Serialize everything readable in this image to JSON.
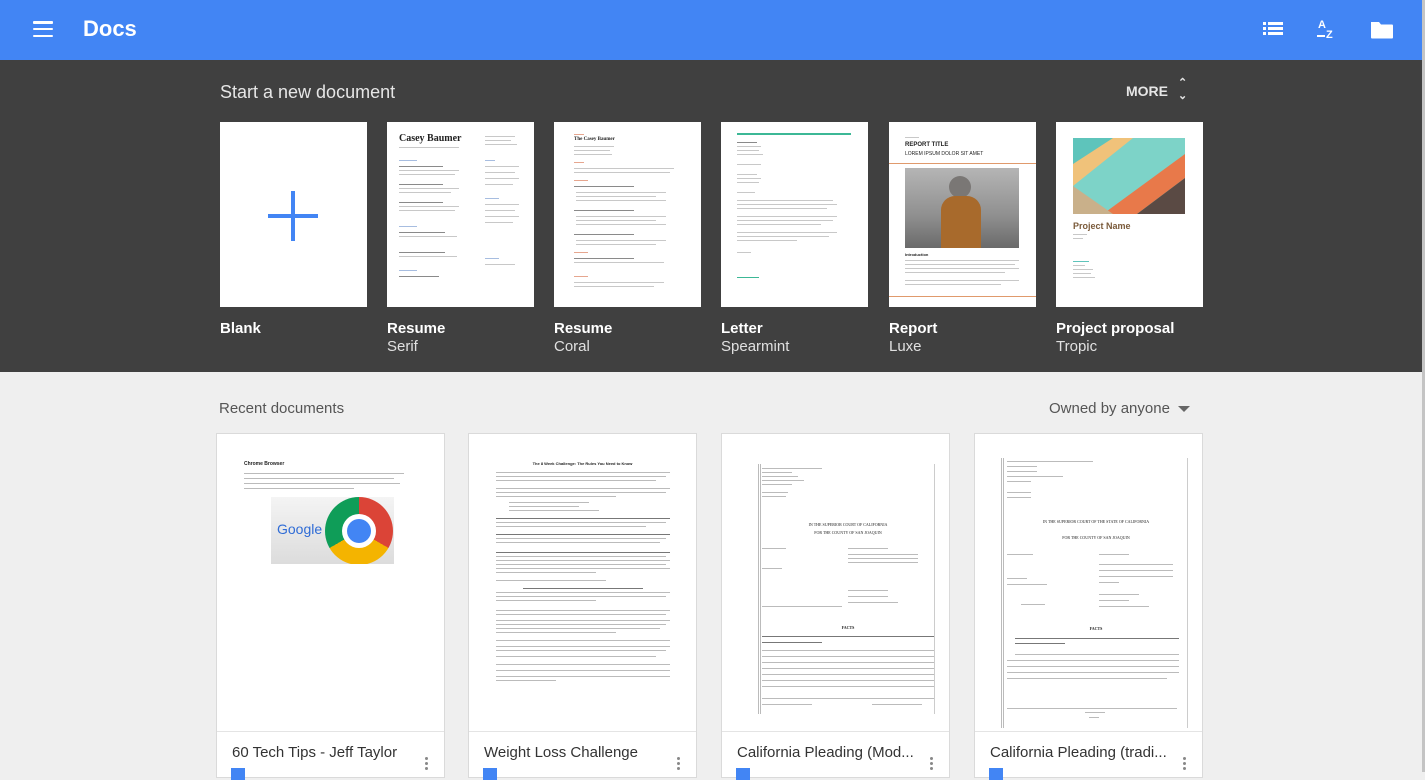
{
  "app": {
    "title": "Docs"
  },
  "templates": {
    "heading": "Start a new document",
    "more_label": "MORE",
    "items": [
      {
        "name": "Blank",
        "sub": ""
      },
      {
        "name": "Resume",
        "sub": "Serif",
        "thumb_title": "Casey Baumer"
      },
      {
        "name": "Resume",
        "sub": "Coral",
        "thumb_title": "The Casey Baumer"
      },
      {
        "name": "Letter",
        "sub": "Spearmint"
      },
      {
        "name": "Report",
        "sub": "Luxe",
        "thumb_title": "REPORT TITLE",
        "thumb_subtitle": "LOREM IPSUM DOLOR SIT AMET",
        "thumb_section": "Introduction"
      },
      {
        "name": "Project proposal",
        "sub": "Tropic",
        "thumb_title": "Project Name"
      }
    ]
  },
  "recent": {
    "heading": "Recent documents",
    "owner_filter": "Owned by anyone",
    "docs": [
      {
        "title": "60 Tech Tips - Jeff Taylor",
        "thumb_heading": "Chrome Browser",
        "thumb_logo": "Google"
      },
      {
        "title": "Weight Loss Challenge",
        "thumb_heading": "The 8 Week Challenge: The Rules You Need to Know"
      },
      {
        "title": "California Pleading (Mod...",
        "thumb_heading": "IN THE SUPERIOR COURT OF CALIFORNIA",
        "thumb_sub": "FOR THE COUNTY OF SAN JOAQUIN",
        "thumb_facts": "FACTS"
      },
      {
        "title": "California Pleading (tradi...",
        "thumb_heading": "IN THE SUPERIOR COURT OF THE STATE OF CALIFORNIA",
        "thumb_sub": "FOR THE COUNTY OF SAN JOAQUIN",
        "thumb_facts": "FACTS"
      }
    ]
  },
  "colors": {
    "topbar": "#4285f4",
    "templates_bg": "#404040",
    "accent": "#4285f4"
  },
  "icons": [
    "menu-icon",
    "list-view-icon",
    "sort-az-icon",
    "folder-icon",
    "expand-icon",
    "plus-icon",
    "more-vert-icon",
    "docs-file-icon"
  ]
}
